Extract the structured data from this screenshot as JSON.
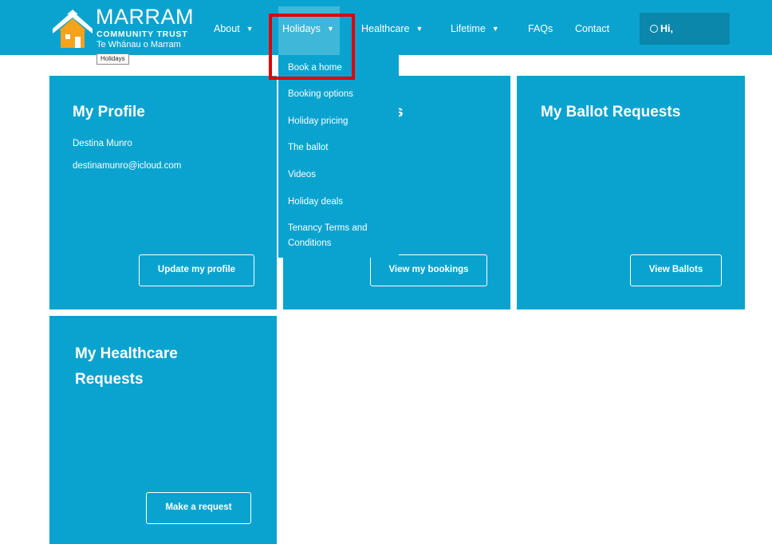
{
  "logo": {
    "name": "MARRAM",
    "sub": "COMMUNITY TRUST",
    "sub2": "Te Whānau o Marram",
    "icon": "house-logo-icon",
    "brand_blue": "#0aa3cf",
    "brand_orange": "#f6a21b"
  },
  "tooltip": "Holidays",
  "nav": {
    "about": "About",
    "holidays": "Holidays",
    "healthcare": "Healthcare",
    "lifetime": "Lifetime",
    "faqs": "FAQs",
    "contact": "Contact",
    "greeting": "Hi,"
  },
  "dropdown": {
    "items": [
      "Book a home",
      "Booking options",
      "Holiday pricing",
      "The ballot",
      "Videos",
      "Holiday deals",
      "Tenancy Terms and Conditions"
    ]
  },
  "cards": {
    "profile": {
      "title": "My Profile",
      "name": "Destina Munro",
      "email": "destinamunro@icloud.com",
      "button": "Update my profile"
    },
    "bookings": {
      "title_fragment": "s",
      "button": "View my bookings"
    },
    "ballots": {
      "title": "My Ballot Requests",
      "button": "View Ballots"
    },
    "healthcare": {
      "title_line1": "My Healthcare",
      "title_line2": "Requests",
      "button": "Make a request"
    }
  },
  "colors": {
    "card_blue": "#0aa3cf",
    "button_dark": "#0a87aa",
    "highlight_red": "#e00000"
  }
}
